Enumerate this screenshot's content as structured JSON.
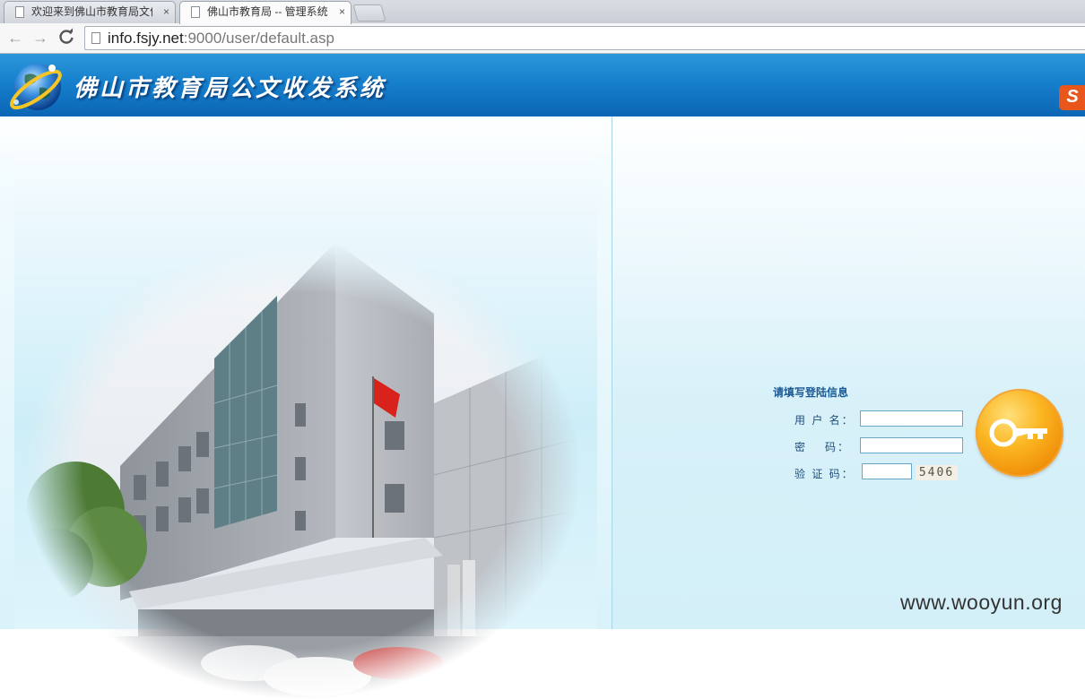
{
  "browser": {
    "tabs": [
      {
        "title": "欢迎来到佛山市教育局文件",
        "active": false,
        "close_label": "×"
      },
      {
        "title": "佛山市教育局 -- 管理系统",
        "active": true,
        "close_label": "×"
      }
    ],
    "nav": {
      "back_icon": "←",
      "forward_icon": "→",
      "reload_icon": "C"
    },
    "url_host": "info.fsjy.net",
    "url_rest": ":9000/user/default.asp"
  },
  "header": {
    "title": "佛山市教育局公文收发系统",
    "logo_icon": "globe-icon",
    "extension_icon": "sogou-icon",
    "extension_label": "S"
  },
  "login": {
    "heading": "请填写登陆信息",
    "username_label": "用 户 名：",
    "password_label_a": "密",
    "password_label_b": "码：",
    "code_label": "验 证 码：",
    "username_value": "",
    "password_value": "",
    "code_value": "",
    "captcha": "5406",
    "submit_icon": "key-icon"
  },
  "watermark": "www.wooyun.org",
  "colors": {
    "header_blue": "#1680cd",
    "label_blue": "#1f4e7a",
    "key_orange": "#fbb521"
  }
}
